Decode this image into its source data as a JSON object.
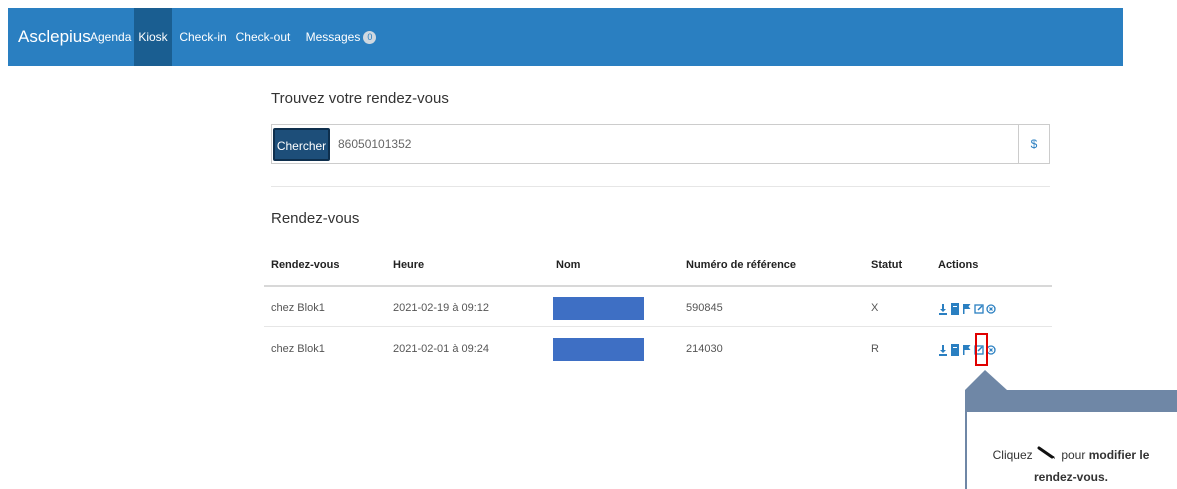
{
  "navbar": {
    "brand": "Asclepius",
    "items": [
      {
        "label": "Agenda"
      },
      {
        "label": "Kiosk",
        "active": true
      },
      {
        "label": "Check-in"
      },
      {
        "label": "Check-out"
      },
      {
        "label": "Messages",
        "badge": "0"
      }
    ]
  },
  "search": {
    "title": "Trouvez votre rendez-vous",
    "button_label": "Chercher",
    "value": "86050101352",
    "addon": "$"
  },
  "appointments": {
    "title": "Rendez-vous",
    "columns": [
      "Rendez-vous",
      "Heure",
      "Nom",
      "Numéro de référence",
      "Statut",
      "Actions"
    ],
    "rows": [
      {
        "rendezvous": "chez Blok1",
        "heure": "2021-02-19 à 09:12",
        "nom": "",
        "reference": "590845",
        "statut": "X"
      },
      {
        "rendezvous": "chez Blok1",
        "heure": "2021-02-01 à 09:24",
        "nom": "",
        "reference": "214030",
        "statut": "R"
      }
    ],
    "action_icons": [
      "download-icon",
      "document-icon",
      "flag-icon",
      "edit-icon",
      "cancel-icon"
    ]
  },
  "callout": {
    "text_before": "Cliquez",
    "text_mid": "pour",
    "text_bold": "modifier le rendez-vous.",
    "icon": "pencil-icon"
  },
  "colors": {
    "navbar": "#2a7fc1",
    "navbar_active": "#1a5e91",
    "button": "#1d4e79",
    "name_mask": "#3e6fc4",
    "highlight": "#e00000",
    "callout": "#6f87a6"
  }
}
